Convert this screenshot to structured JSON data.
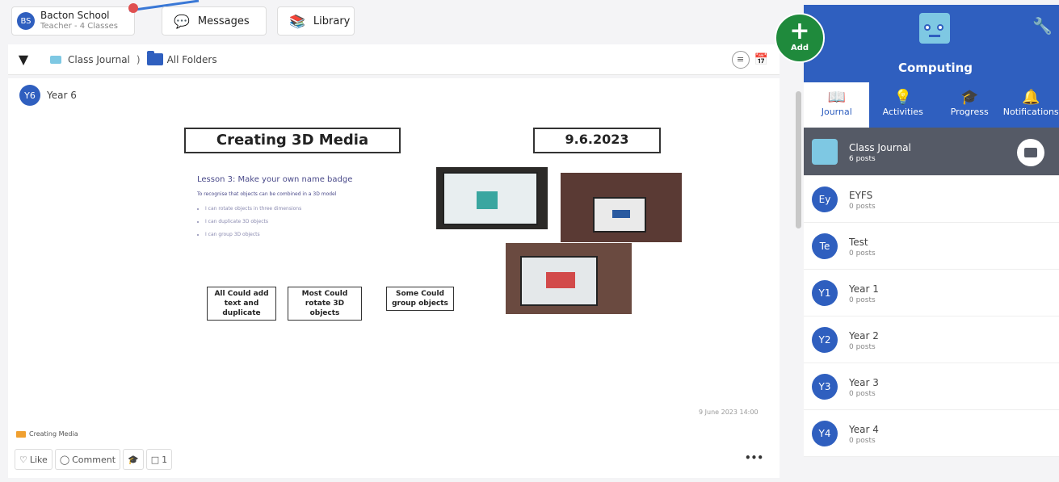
{
  "header": {
    "school_initials": "BS",
    "school_name": "Bacton School",
    "school_sub": "Teacher - 4 Classes",
    "messages_label": "Messages",
    "library_label": "Library"
  },
  "breadcrumb": {
    "class_journal": "Class Journal",
    "separator": ")",
    "all_folders": "All Folders"
  },
  "post": {
    "author_initials": "Y6",
    "author": "Year 6",
    "slide_title": "Creating 3D Media",
    "slide_date": "9.6.2023",
    "lesson": "Lesson 3: Make your own name badge",
    "objective": "To recognise that objects can be combined in a 3D model",
    "bullets": [
      "I can rotate objects in three dimensions",
      "I can duplicate 3D objects",
      "I can group 3D objects"
    ],
    "tier_all": "All Could add text and duplicate",
    "tier_most": "Most Could rotate 3D objects",
    "tier_some": "Some Could group objects",
    "timestamp": "9 June 2023 14:00",
    "folder": "Creating Media",
    "like": "Like",
    "comment": "Comment",
    "files_count": "1",
    "more": "•••"
  },
  "add_button": {
    "label": "Add"
  },
  "panel": {
    "subject": "Computing",
    "tabs": [
      "Journal",
      "Activities",
      "Progress",
      "Notifications"
    ],
    "journals": [
      {
        "initials": "",
        "name": "Class Journal",
        "posts": "6 posts"
      },
      {
        "initials": "Ey",
        "name": "EYFS",
        "posts": "0 posts"
      },
      {
        "initials": "Te",
        "name": "Test",
        "posts": "0 posts"
      },
      {
        "initials": "Y1",
        "name": "Year 1",
        "posts": "0 posts"
      },
      {
        "initials": "Y2",
        "name": "Year 2",
        "posts": "0 posts"
      },
      {
        "initials": "Y3",
        "name": "Year 3",
        "posts": "0 posts"
      },
      {
        "initials": "Y4",
        "name": "Year 4",
        "posts": "0 posts"
      }
    ]
  },
  "colors": {
    "brand": "#2f5fbf",
    "add": "#1f8a3c",
    "selected": "#555a66"
  }
}
